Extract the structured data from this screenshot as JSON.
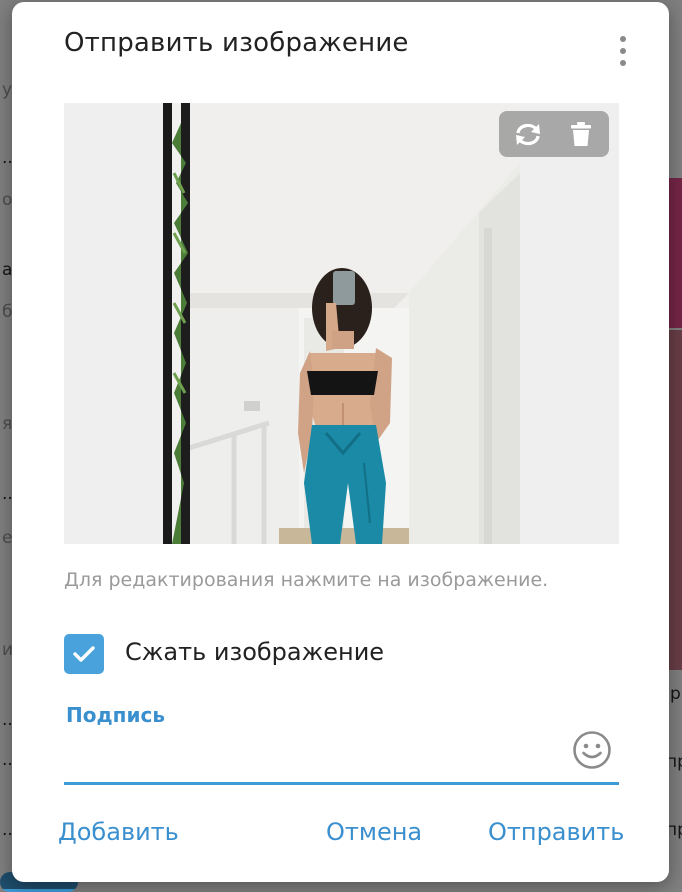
{
  "background": {
    "left_fragments": [
      "у.",
      "...",
      "ос",
      "а.",
      "бя",
      "я",
      "...",
      "ез",
      "ит",
      "...",
      "...",
      "..."
    ],
    "right_fragments": [
      "р",
      "пр",
      "пр"
    ]
  },
  "dialog": {
    "title": "Отправить изображение",
    "more_icon": "more-vertical-icon",
    "photo_toolbar": {
      "replace_icon": "replace-icon",
      "delete_icon": "trash-icon"
    },
    "hint": "Для редактирования нажмите на изображение.",
    "compress": {
      "label": "Сжать изображение",
      "checked": true
    },
    "caption": {
      "label": "Подпись",
      "value": "",
      "placeholder": "",
      "emoji_icon": "smile-icon"
    },
    "buttons": {
      "add": "Добавить",
      "cancel": "Отмена",
      "send": "Отправить"
    }
  },
  "colors": {
    "accent": "#3d9bd6",
    "checkbox": "#4aa2dc",
    "title": "#222222",
    "hint": "#9a9a9a"
  }
}
